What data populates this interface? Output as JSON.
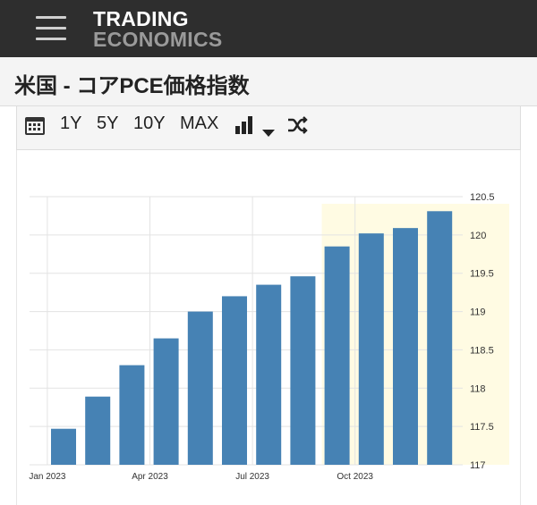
{
  "header": {
    "brand_line1": "TRADING",
    "brand_line2": "ECONOMICS"
  },
  "page": {
    "title": "米国 - コアPCE価格指数"
  },
  "toolbar": {
    "range_1y": "1Y",
    "range_5y": "5Y",
    "range_10y": "10Y",
    "range_max": "MAX"
  },
  "chart_data": {
    "type": "bar",
    "categories": [
      "2023-01",
      "2023-02",
      "2023-03",
      "2023-04",
      "2023-05",
      "2023-06",
      "2023-07",
      "2023-08",
      "2023-09",
      "2023-10",
      "2023-11",
      "2023-12"
    ],
    "values": [
      117.47,
      117.89,
      118.3,
      118.65,
      119.0,
      119.2,
      119.35,
      119.46,
      119.85,
      120.02,
      120.09,
      120.31
    ],
    "x_tick_labels": [
      "Jan 2023",
      "Apr 2023",
      "Jul 2023",
      "Oct 2023"
    ],
    "y_tick_labels": [
      "117",
      "117.5",
      "118",
      "118.5",
      "119",
      "119.5",
      "120",
      "120.5"
    ],
    "ylim": [
      117,
      120.5
    ],
    "bar_color": "#4682b4",
    "grid": true
  }
}
